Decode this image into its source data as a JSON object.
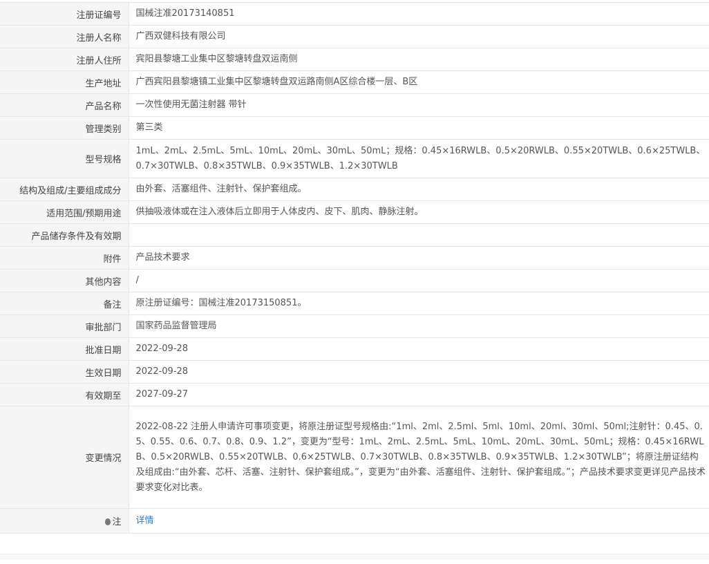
{
  "record": {
    "rows": [
      {
        "label": "注册证编号",
        "value": "国械注准20173140851"
      },
      {
        "label": "注册人名称",
        "value": "广西双健科技有限公司"
      },
      {
        "label": "注册人住所",
        "value": "宾阳县黎塘工业集中区黎塘转盘双运南侧"
      },
      {
        "label": "生产地址",
        "value": "广西宾阳县黎塘镇工业集中区黎塘转盘双运路南侧A区综合楼一层、B区"
      },
      {
        "label": "产品名称",
        "value": "一次性使用无菌注射器 带针"
      },
      {
        "label": "管理类别",
        "value": "第三类"
      },
      {
        "label": "型号规格",
        "value": "1mL、2mL、2.5mL、5mL、10mL、20mL、30mL、50mL；规格：0.45×16RWLB、0.5×20RWLB、0.55×20TWLB、0.6×25TWLB、0.7×30TWLB、0.8×35TWLB、0.9×35TWLB、1.2×30TWLB"
      },
      {
        "label": "结构及组成/主要组成成分",
        "value": "由外套、活塞组件、注射针、保护套组成。"
      },
      {
        "label": "适用范围/预期用途",
        "value": "供抽吸液体或在注入液体后立即用于人体皮内、皮下、肌肉、静脉注射。"
      },
      {
        "label": "产品储存条件及有效期",
        "value": ""
      },
      {
        "label": "附件",
        "value": "产品技术要求"
      },
      {
        "label": "其他内容",
        "value": "/"
      },
      {
        "label": "备注",
        "value": "原注册证编号：国械注准20173150851。"
      },
      {
        "label": "审批部门",
        "value": "国家药品监督管理局"
      },
      {
        "label": "批准日期",
        "value": "2022-09-28"
      },
      {
        "label": "生效日期",
        "value": "2022-09-28"
      },
      {
        "label": "有效期至",
        "value": "2027-09-27"
      },
      {
        "label": "变更情况",
        "value": "2022-08-22 注册人申请许可事项变更，将原注册证型号规格由:“1ml、2ml、2.5ml、5ml、10ml、20ml、30ml、50ml;注射针：0.45、0.5、0.55、0.6、0.7、0.8、0.9、1.2”，变更为“型号：1mL、2mL、2.5mL、5mL、10mL、20mL、30mL、50mL；规格：0.45×16RWLB、0.5×20RWLB、0.55×20TWLB、0.6×25TWLB、0.7×30TWLB、0.8×35TWLB、0.9×35TWLB、1.2×30TWLB”；将原注册证结构及组成由:“由外套、芯杆、活塞、注射针、保护套组成。”，变更为“由外套、活塞组件、注射针、保护套组成。”；产品技术要求变更详见产品技术要求变化对比表。"
      }
    ],
    "note": {
      "label": "注",
      "icon": "lightbulb-icon",
      "link_text": "详情"
    }
  },
  "colors": {
    "label_bg": "#f5f5f5",
    "border": "#e6e6e6",
    "link": "#2c7fc1",
    "text": "#555555"
  }
}
